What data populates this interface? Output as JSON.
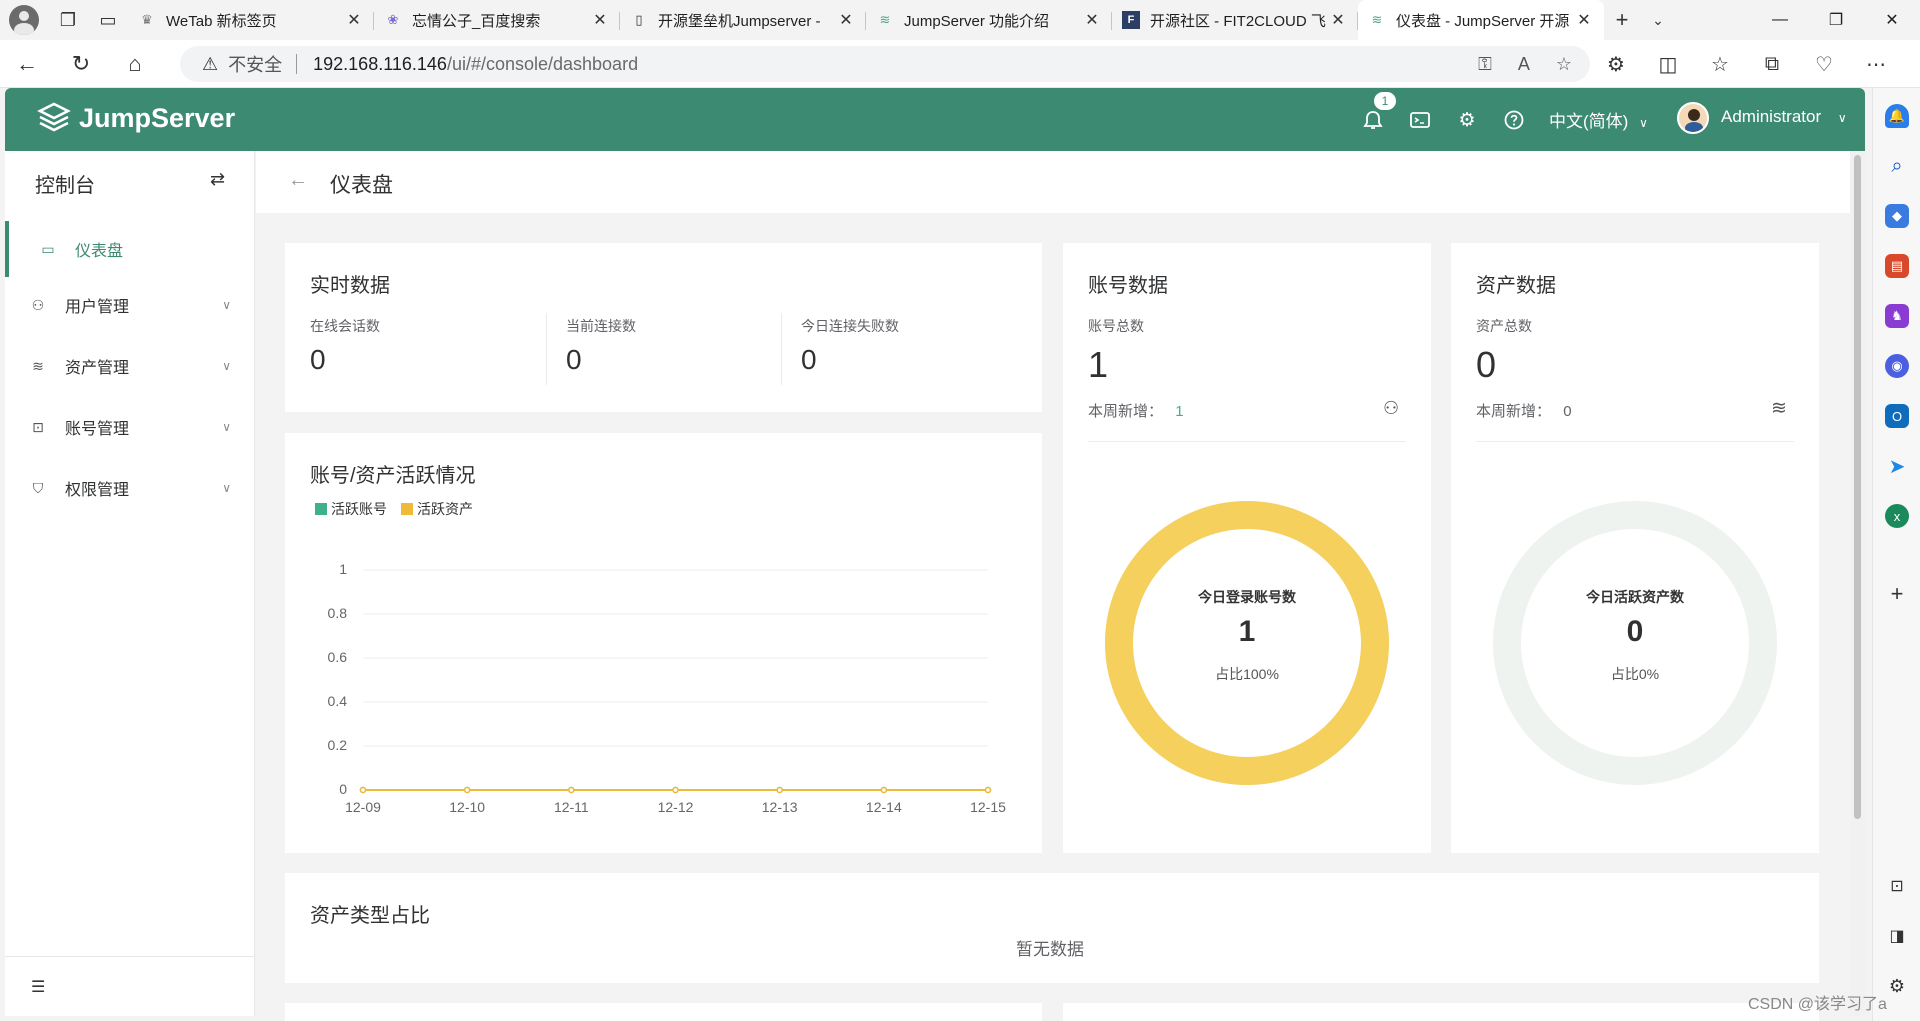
{
  "browser": {
    "tabs": [
      {
        "title": "WeTab 新标签页",
        "favicon": "wetab-icon"
      },
      {
        "title": "忘情公子_百度搜索",
        "favicon": "baidu-icon"
      },
      {
        "title": "开源堡垒机Jumpserver -",
        "favicon": "page-icon"
      },
      {
        "title": "JumpServer 功能介绍",
        "favicon": "jumpserver-icon"
      },
      {
        "title": "开源社区 - FIT2CLOUD 飞",
        "favicon": "fit2cloud-icon"
      },
      {
        "title": "仪表盘 - JumpServer 开源",
        "favicon": "jumpserver-icon",
        "active": true
      }
    ],
    "address": {
      "security_label": "不安全",
      "url_host": "192.168.116.146",
      "url_path": "/ui/#/console/dashboard"
    }
  },
  "header": {
    "brand": "JumpServer",
    "notification_count": "1",
    "language": "中文(简体)",
    "user": "Administrator",
    "brand_color": "#3d8a72"
  },
  "sidebar": {
    "title": "控制台",
    "items": [
      {
        "label": "仪表盘",
        "icon": "dashboard-icon",
        "active": true
      },
      {
        "label": "用户管理",
        "icon": "users-icon"
      },
      {
        "label": "资产管理",
        "icon": "layers-icon"
      },
      {
        "label": "账号管理",
        "icon": "account-icon"
      },
      {
        "label": "权限管理",
        "icon": "shield-icon"
      }
    ]
  },
  "page": {
    "title": "仪表盘"
  },
  "realtime": {
    "title": "实时数据",
    "stats": [
      {
        "label": "在线会话数",
        "value": "0"
      },
      {
        "label": "当前连接数",
        "value": "0"
      },
      {
        "label": "今日连接失败数",
        "value": "0"
      }
    ]
  },
  "accounts": {
    "title": "账号数据",
    "total_label": "账号总数",
    "total": "1",
    "weekly_label": "本周新增：",
    "weekly": "1",
    "donut_label": "今日登录账号数",
    "donut_value": "1",
    "donut_ratio": "占比100%",
    "donut_fraction": 1.0,
    "donut_color": "#f5d05c"
  },
  "assets": {
    "title": "资产数据",
    "total_label": "资产总数",
    "total": "0",
    "weekly_label": "本周新增：",
    "weekly": "0",
    "donut_label": "今日活跃资产数",
    "donut_value": "0",
    "donut_ratio": "占比0%",
    "donut_fraction": 0.0,
    "donut_color": "#eef3f0"
  },
  "activity": {
    "title": "账号/资产活跃情况"
  },
  "asset_types": {
    "title": "资产类型占比",
    "empty": "暂无数据"
  },
  "chart_data": {
    "type": "line",
    "categories": [
      "12-09",
      "12-10",
      "12-11",
      "12-12",
      "12-13",
      "12-14",
      "12-15"
    ],
    "series": [
      {
        "name": "活跃账号",
        "values": [
          0,
          0,
          0,
          0,
          0,
          0,
          0
        ],
        "color": "#3fb08e"
      },
      {
        "name": "活跃资产",
        "values": [
          0,
          0,
          0,
          0,
          0,
          0,
          0
        ],
        "color": "#f0b93a"
      }
    ],
    "ylim": [
      0,
      1
    ],
    "yticks": [
      "0",
      "0.2",
      "0.4",
      "0.6",
      "0.8",
      "1"
    ],
    "grid": true,
    "legend_position": "top-left"
  },
  "watermark": "CSDN @该学习了a"
}
